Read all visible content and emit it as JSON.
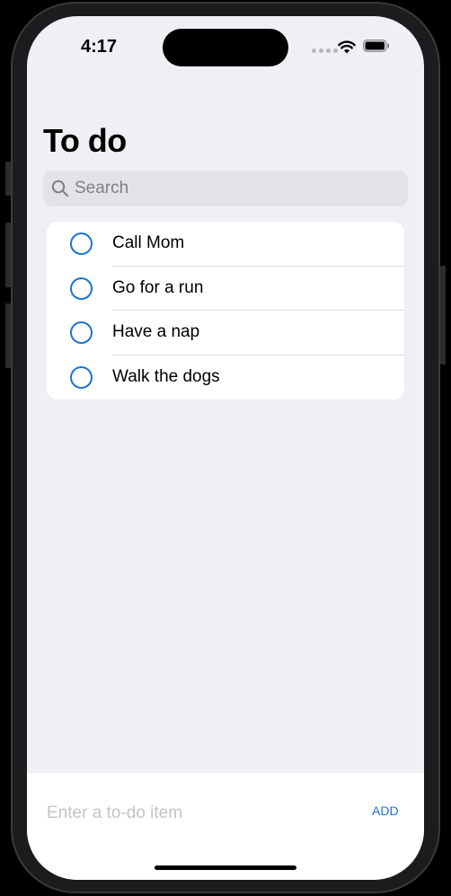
{
  "status_bar": {
    "time": "4:17",
    "icons": [
      "signal-dots-icon",
      "wifi-icon",
      "battery-icon"
    ]
  },
  "header": {
    "title": "To do"
  },
  "search": {
    "placeholder": "Search",
    "value": ""
  },
  "todos": {
    "items": [
      {
        "label": "Call Mom",
        "done": false
      },
      {
        "label": "Go for a run",
        "done": false
      },
      {
        "label": "Have a nap",
        "done": false
      },
      {
        "label": "Walk the dogs",
        "done": false
      }
    ]
  },
  "composer": {
    "placeholder": "Enter a to-do item",
    "value": "",
    "add_label": "ADD"
  },
  "colors": {
    "accent": "#1b74d2",
    "background": "#efeff4",
    "card": "#ffffff",
    "text": "#000000",
    "placeholder": "#c4c4c8"
  }
}
